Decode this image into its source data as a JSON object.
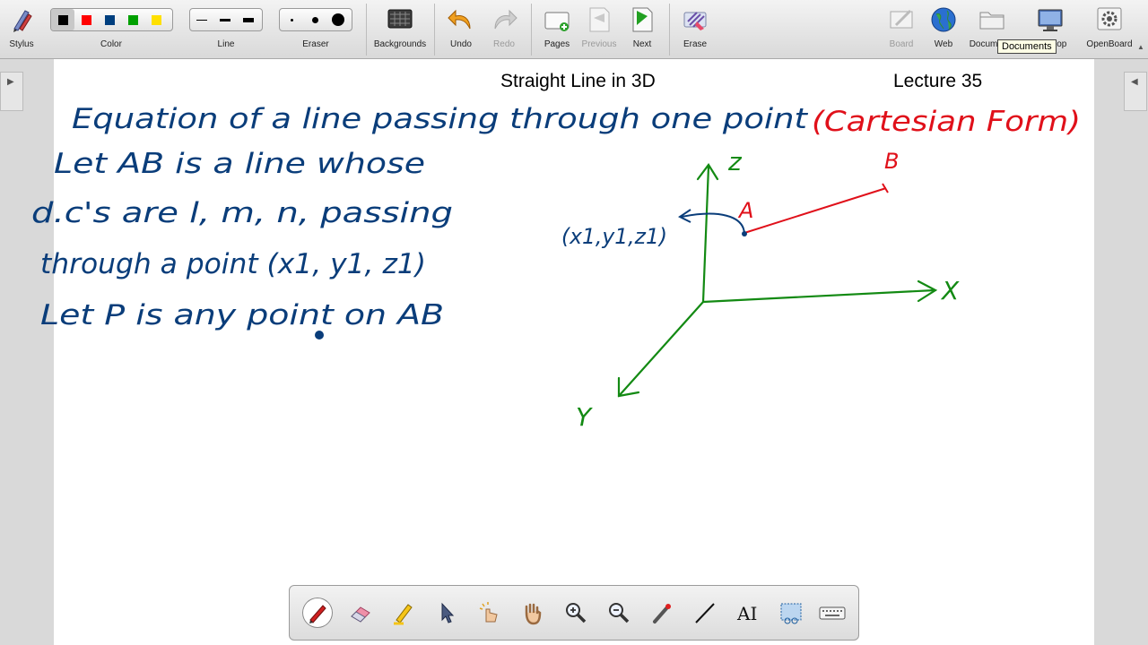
{
  "toolbar": {
    "stylus": "Stylus",
    "color": "Color",
    "line": "Line",
    "eraser": "Eraser",
    "backgrounds": "Backgrounds",
    "undo": "Undo",
    "redo": "Redo",
    "pages": "Pages",
    "previous": "Previous",
    "next": "Next",
    "erase": "Erase",
    "board": "Board",
    "web": "Web",
    "documents": "Documents",
    "desktop": "Desktop",
    "openboard": "OpenBoard",
    "colors": [
      "#000000",
      "#ff0000",
      "#003f7f",
      "#00a000",
      "#ffff00"
    ]
  },
  "tooltip": "Documents",
  "page": {
    "title": "Straight Line in 3D",
    "lecture": "Lecture 35"
  },
  "ink": {
    "line1": "Equation of a line passing through one point",
    "line1_red": "(Cartesian Form)",
    "line2": "Let AB is a line whose",
    "line3": "d.c's are l, m, n, passing",
    "line4": "through a point (x1, y1, z1)",
    "line5": "Let P is any point on AB",
    "axis_z": "z",
    "axis_x": "X",
    "axis_y": "Y",
    "point_a": "A",
    "point_b": "B",
    "point_label": "(x1,y1,z1)"
  },
  "colors": {
    "ink_blue": "#0a3d7a",
    "ink_red": "#e0101a",
    "ink_green": "#138a13"
  },
  "tools": [
    "pen-icon",
    "eraser-icon",
    "highlighter-icon",
    "pointer-icon",
    "laser-hand-icon",
    "hand-icon",
    "zoom-in-icon",
    "zoom-out-icon",
    "laser-pointer-icon",
    "line-icon",
    "text-icon",
    "capture-icon",
    "keyboard-icon"
  ]
}
